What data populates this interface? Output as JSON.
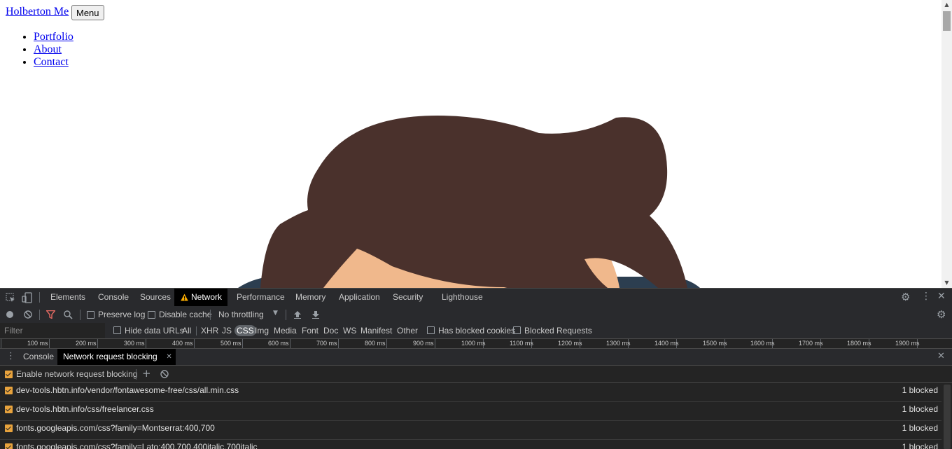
{
  "page": {
    "brand": "Holberton Me",
    "menu_button": "Menu",
    "nav": [
      "Portfolio",
      "About",
      "Contact"
    ]
  },
  "devtools": {
    "tabs": [
      "Elements",
      "Console",
      "Sources",
      "Network",
      "Performance",
      "Memory",
      "Application",
      "Security",
      "Lighthouse"
    ],
    "active_tab": "Network",
    "toolbar": {
      "preserve_log": "Preserve log",
      "disable_cache": "Disable cache",
      "throttling": "No throttling"
    },
    "filter": {
      "placeholder": "Filter",
      "hide_data_urls": "Hide data URLs",
      "types": [
        "All",
        "XHR",
        "JS",
        "CSS",
        "Img",
        "Media",
        "Font",
        "Doc",
        "WS",
        "Manifest",
        "Other"
      ],
      "selected_type": "CSS",
      "has_blocked_cookies": "Has blocked cookies",
      "blocked_requests": "Blocked Requests"
    },
    "timeline_labels": [
      "100 ms",
      "200 ms",
      "300 ms",
      "400 ms",
      "500 ms",
      "600 ms",
      "700 ms",
      "800 ms",
      "900 ms",
      "1000 ms",
      "1100 ms",
      "1200 ms",
      "1300 ms",
      "1400 ms",
      "1500 ms",
      "1600 ms",
      "1700 ms",
      "1800 ms",
      "1900 ms",
      "200"
    ],
    "drawer": {
      "tabs": [
        "Console",
        "Network request blocking"
      ],
      "active_tab": "Network request blocking",
      "enable_label": "Enable network request blocking",
      "patterns": [
        {
          "pattern": "dev-tools.hbtn.info/vendor/fontawesome-free/css/all.min.css",
          "count": "1 blocked"
        },
        {
          "pattern": "dev-tools.hbtn.info/css/freelancer.css",
          "count": "1 blocked"
        },
        {
          "pattern": "fonts.googleapis.com/css?family=Montserrat:400,700",
          "count": "1 blocked"
        },
        {
          "pattern": "fonts.googleapis.com/css?family=Lato:400,700,400italic,700italic",
          "count": "1 blocked"
        }
      ]
    }
  },
  "colors": {
    "hair": "#4a312c",
    "skin": "#f0b88c",
    "shirt": "#2c3e50",
    "active_tab_bg": "#000000",
    "checkbox_accent": "#e8a33d",
    "warning": "#f9ab00"
  }
}
